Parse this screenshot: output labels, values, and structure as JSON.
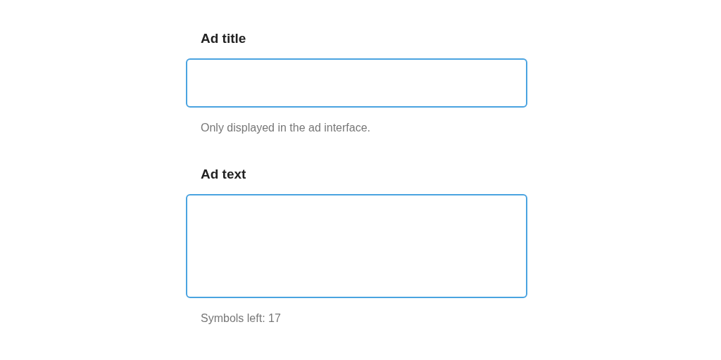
{
  "fields": [
    {
      "kind": "input",
      "label": "Ad title",
      "helper": "Only displayed in the ad interface."
    },
    {
      "kind": "textarea",
      "label": "Ad text",
      "helper": "Symbols left: 17"
    }
  ]
}
